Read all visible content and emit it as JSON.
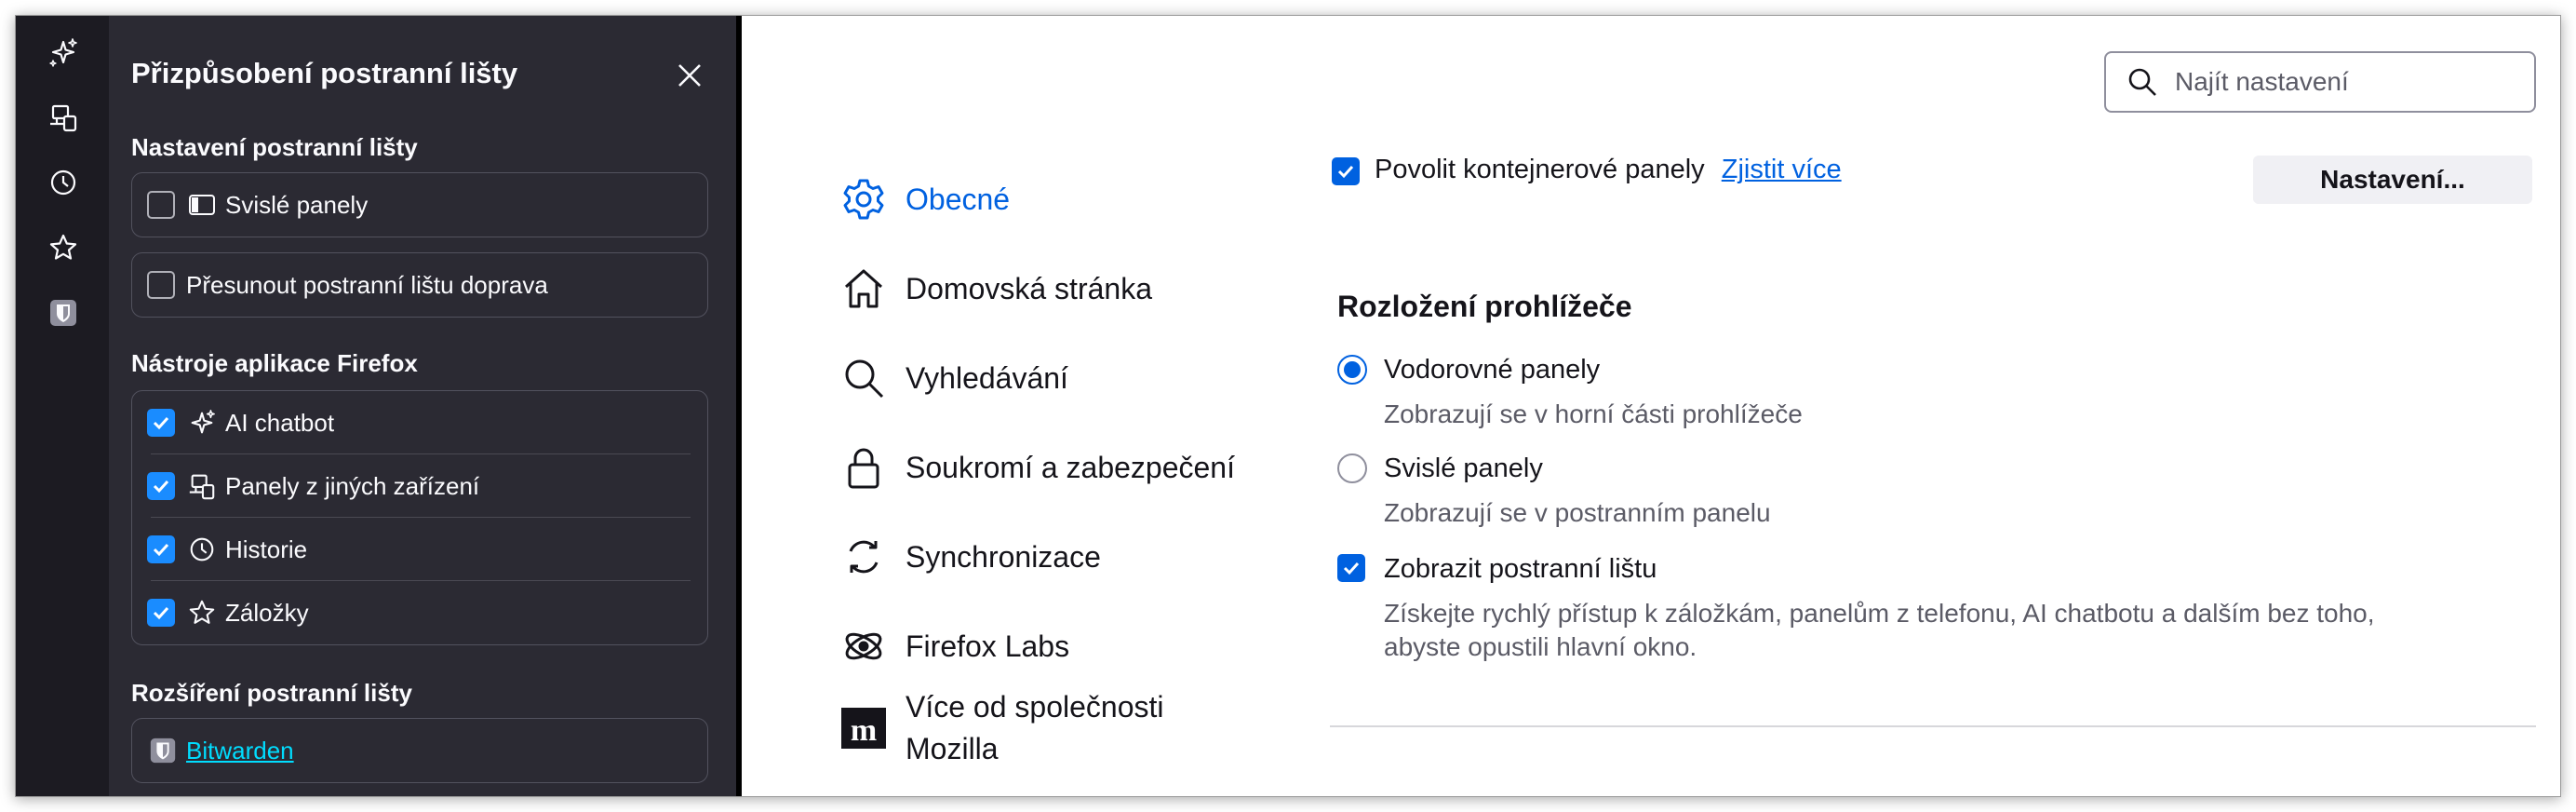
{
  "panel": {
    "title": "Přizpůsobení postranní lišty",
    "sidebar_settings_heading": "Nastavení postranní lišty",
    "vertical_tabs_label": "Svislé panely",
    "move_right_label": "Přesunout postranní lištu doprava",
    "tools_heading": "Nástroje aplikace Firefox",
    "tools": [
      {
        "label": "AI chatbot",
        "icon": "sparkle-icon",
        "checked": true
      },
      {
        "label": "Panely z jiných zařízení",
        "icon": "synced-tabs-icon",
        "checked": true
      },
      {
        "label": "Historie",
        "icon": "history-icon",
        "checked": true
      },
      {
        "label": "Záložky",
        "icon": "bookmark-star-icon",
        "checked": true
      }
    ],
    "extensions_heading": "Rozšíření postranní lišty",
    "extension_name": "Bitwarden"
  },
  "search": {
    "placeholder": "Najít nastavení"
  },
  "nav": {
    "items": [
      {
        "label": "Obecné",
        "icon": "gear-icon",
        "active": true
      },
      {
        "label": "Domovská stránka",
        "icon": "home-icon"
      },
      {
        "label": "Vyhledávání",
        "icon": "search-icon"
      },
      {
        "label": "Soukromí a zabezpečení",
        "icon": "lock-icon"
      },
      {
        "label": "Synchronizace",
        "icon": "sync-icon"
      },
      {
        "label": "Firefox Labs",
        "icon": "labs-icon"
      },
      {
        "label_line1": "Více od společnosti",
        "label_line2": "Mozilla",
        "icon": "mozilla-icon"
      }
    ]
  },
  "content": {
    "containers_label": "Povolit kontejnerové panely",
    "learn_more": "Zjistit více",
    "settings_button": "Nastavení...",
    "layout_heading": "Rozložení prohlížeče",
    "horizontal_tabs": "Vodorovné panely",
    "horizontal_tabs_desc": "Zobrazují se v horní části prohlížeče",
    "vertical_tabs": "Svislé panely",
    "vertical_tabs_desc": "Zobrazují se v postranním panelu",
    "show_sidebar": "Zobrazit postranní lištu",
    "show_sidebar_desc_line1": "Získejte rychlý přístup k záložkám, panelům z telefonu, AI chatbotu a dalším bez toho,",
    "show_sidebar_desc_line2": "abyste opustili hlavní okno."
  },
  "colors": {
    "accent": "#0061e0",
    "panel_bg": "#2b2a33",
    "strip_bg": "#1c1b22",
    "checkbox_on": "#1a8cff",
    "link_cyan": "#00ddff"
  }
}
